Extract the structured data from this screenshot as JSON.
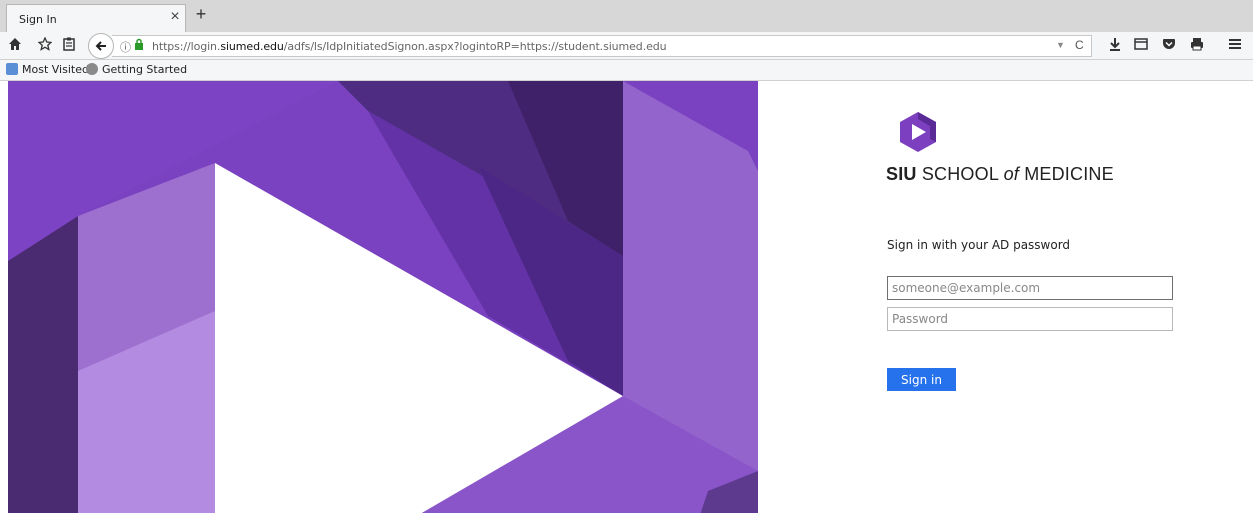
{
  "browser": {
    "tab_title": "Sign In",
    "tab_close": "×",
    "new_tab": "+",
    "url_prefix": "https://login.",
    "url_domain": "siumed.edu",
    "url_path": "/adfs/ls/IdpInitiatedSignon.aspx?logintoRP=https://student.siumed.edu",
    "bookmarks": [
      {
        "label": "Most Visited"
      },
      {
        "label": "Getting Started"
      }
    ]
  },
  "brand": {
    "siu": "SIU",
    "school": "SCHOOL",
    "of": "of",
    "medicine": "MEDICINE"
  },
  "form": {
    "prompt": "Sign in with your AD password",
    "email_placeholder": "someone@example.com",
    "password_placeholder": "Password",
    "signin_label": "Sign in"
  },
  "colors": {
    "accent_button": "#2672ec",
    "brand_purple": "#7b3fbf"
  }
}
